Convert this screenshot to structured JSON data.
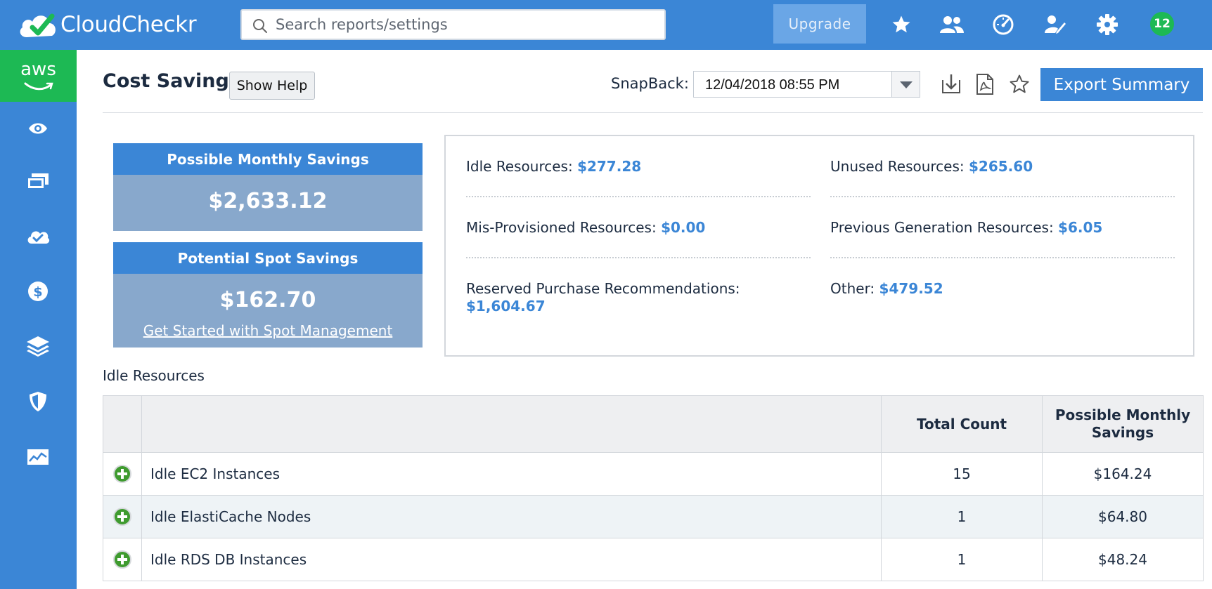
{
  "header": {
    "brand": "CloudCheckr",
    "search_placeholder": "Search reports/settings",
    "upgrade_label": "Upgrade",
    "notification_count": "12",
    "icons": [
      "star-icon",
      "users-icon",
      "speedometer-icon",
      "edit-icon",
      "gear-icon"
    ]
  },
  "sidebar": {
    "platform": "aws",
    "icons": [
      "eye-icon",
      "billing-icon",
      "cloud-check-icon",
      "dollar-icon",
      "layers-icon",
      "shield-icon",
      "chart-icon"
    ]
  },
  "page": {
    "title": "Cost Savings",
    "show_help_label": "Show Help",
    "snapback_label": "SnapBack:",
    "snapback_value": "12/04/2018 08:55 PM",
    "export_label": "Export Summary"
  },
  "cards": {
    "monthly": {
      "title": "Possible Monthly Savings",
      "amount": "$2,633.12"
    },
    "spot": {
      "title": "Potential Spot Savings",
      "amount": "$162.70",
      "link": "Get Started with Spot Management"
    }
  },
  "breakdown": [
    {
      "label": "Idle Resources:",
      "value": "$277.28"
    },
    {
      "label": "Unused Resources:",
      "value": "$265.60"
    },
    {
      "label": "Mis-Provisioned Resources:",
      "value": "$0.00"
    },
    {
      "label": "Previous Generation Resources:",
      "value": "$6.05"
    },
    {
      "label": "Reserved Purchase Recommendations:",
      "value": "$1,604.67"
    },
    {
      "label": "Other:",
      "value": "$479.52"
    }
  ],
  "idle": {
    "section_title": "Idle Resources",
    "columns": {
      "count": "Total Count",
      "savings": "Possible Monthly Savings"
    },
    "rows": [
      {
        "name": "Idle EC2 Instances",
        "count": "15",
        "savings": "$164.24"
      },
      {
        "name": "Idle ElastiCache Nodes",
        "count": "1",
        "savings": "$64.80"
      },
      {
        "name": "Idle RDS DB Instances",
        "count": "1",
        "savings": "$48.24"
      }
    ]
  },
  "colors": {
    "brand_blue": "#3b86d6",
    "accent_green": "#1db954",
    "card_body": "#88a8cc"
  }
}
